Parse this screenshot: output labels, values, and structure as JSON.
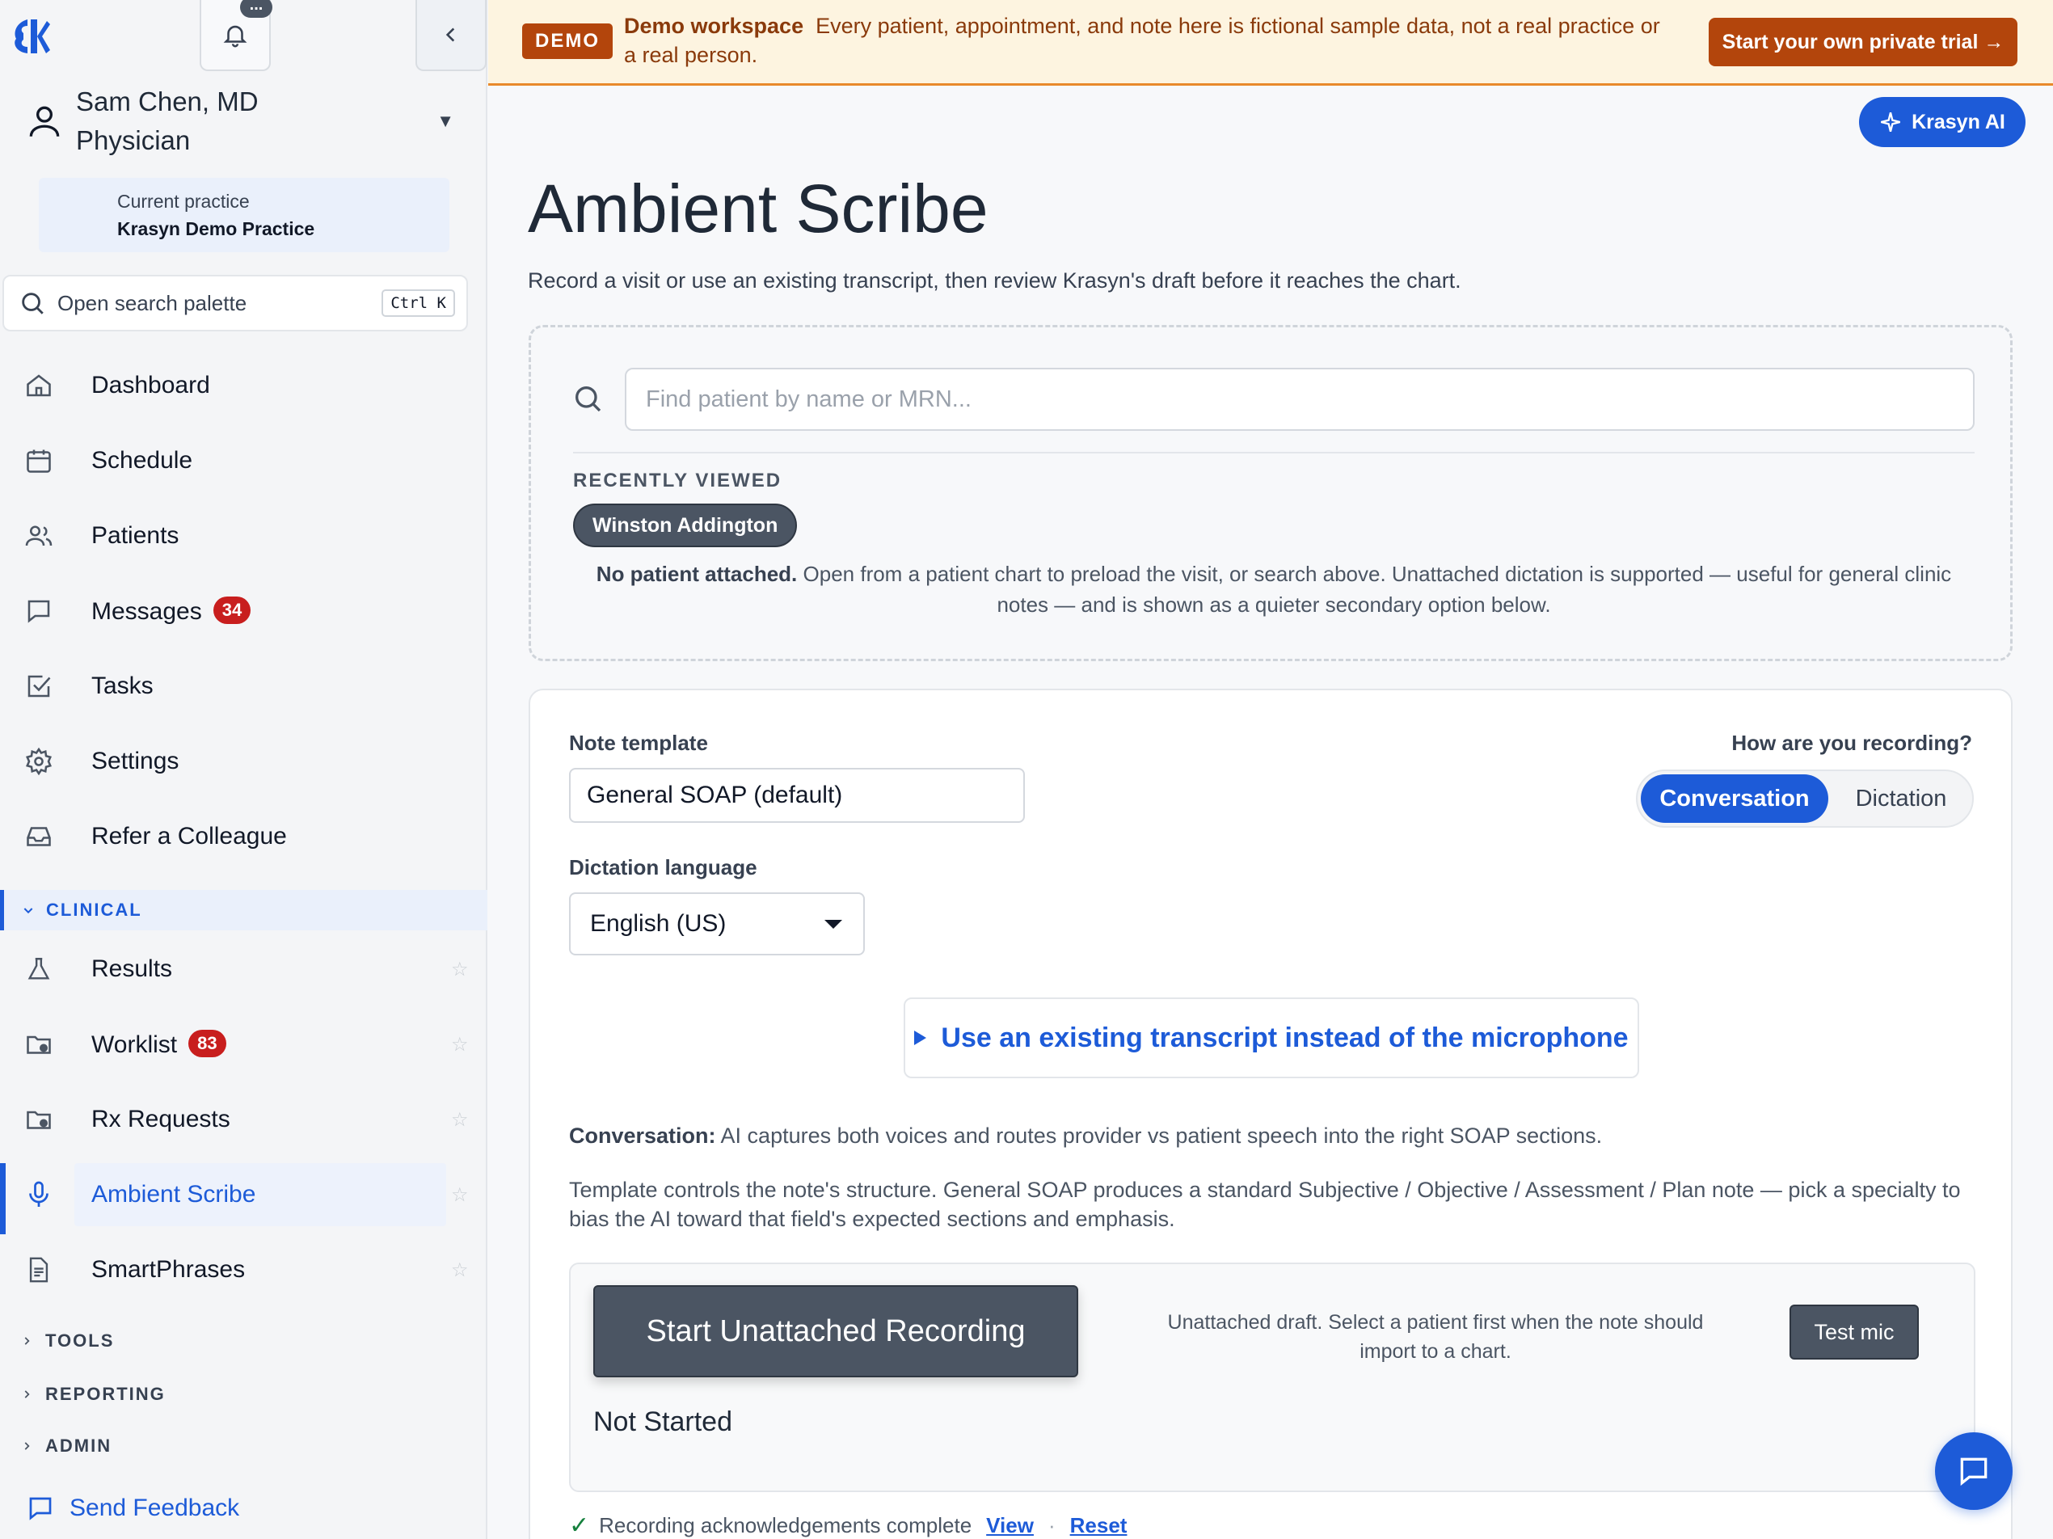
{
  "sidebar": {
    "bell_badge": "...",
    "user": {
      "name": "Sam Chen, MD",
      "role": "Physician"
    },
    "practice": {
      "label": "Current practice",
      "name": "Krasyn Demo Practice"
    },
    "search": {
      "label": "Open search palette",
      "shortcut": "Ctrl K"
    },
    "nav": [
      {
        "label": "Dashboard",
        "icon": "home-icon"
      },
      {
        "label": "Schedule",
        "icon": "calendar-icon"
      },
      {
        "label": "Patients",
        "icon": "users-icon"
      },
      {
        "label": "Messages",
        "icon": "message-icon",
        "badge": "34"
      },
      {
        "label": "Tasks",
        "icon": "checkbox-icon"
      },
      {
        "label": "Settings",
        "icon": "gear-icon"
      },
      {
        "label": "Refer a Colleague",
        "icon": "inbox-icon"
      }
    ],
    "clinical": {
      "label": "CLINICAL",
      "items": [
        {
          "label": "Results",
          "icon": "flask-icon"
        },
        {
          "label": "Worklist",
          "icon": "folder-dot-icon",
          "badge": "83"
        },
        {
          "label": "Rx Requests",
          "icon": "folder-dot-icon"
        },
        {
          "label": "Ambient Scribe",
          "icon": "microphone-icon",
          "active": true
        },
        {
          "label": "SmartPhrases",
          "icon": "document-icon"
        }
      ]
    },
    "sections": [
      "TOOLS",
      "REPORTING",
      "ADMIN"
    ],
    "feedback": "Send Feedback"
  },
  "banner": {
    "tag": "DEMO",
    "title": "Demo workspace",
    "text": "Every patient, appointment, and note here is fictional sample data, not a real practice or a real person.",
    "cta": "Start your own private trial →"
  },
  "ai_button": "Krasyn AI",
  "page": {
    "title": "Ambient Scribe",
    "subtitle": "Record a visit or use an existing transcript, then review Krasyn's draft before it reaches the chart."
  },
  "patient_picker": {
    "placeholder": "Find patient by name or MRN...",
    "recent_label": "RECENTLY VIEWED",
    "recent": [
      "Winston Addington"
    ],
    "no_patient_bold": "No patient attached.",
    "no_patient_text": "Open from a patient chart to preload the visit, or search above. Unattached dictation is supported — useful for general clinic notes — and is shown as a quieter secondary option below."
  },
  "recorder": {
    "template_label": "Note template",
    "template_value": "General SOAP (default)",
    "language_label": "Dictation language",
    "language_value": "English (US)",
    "mode_label": "How are you recording?",
    "modes": [
      "Conversation",
      "Dictation"
    ],
    "mode_selected": "Conversation",
    "transcript_link": "Use an existing transcript instead of the microphone",
    "conv_bold": "Conversation:",
    "conv_text": "AI captures both voices and routes provider vs patient speech into the right SOAP sections.",
    "template_desc": "Template controls the note's structure. General SOAP produces a standard Subjective / Objective / Assessment / Plan note — pick a specialty to bias the AI toward that field's expected sections and emphasis.",
    "start_button": "Start Unattached Recording",
    "unattached_note": "Unattached draft. Select a patient first when the note should import to a chart.",
    "test_mic": "Test mic",
    "status": "Not Started",
    "ack_text": "Recording acknowledgements complete",
    "ack_view": "View",
    "ack_reset": "Reset"
  },
  "colors": {
    "accent": "#1d5bd8",
    "demo": "#b3450c",
    "badge": "#c81e1e"
  }
}
